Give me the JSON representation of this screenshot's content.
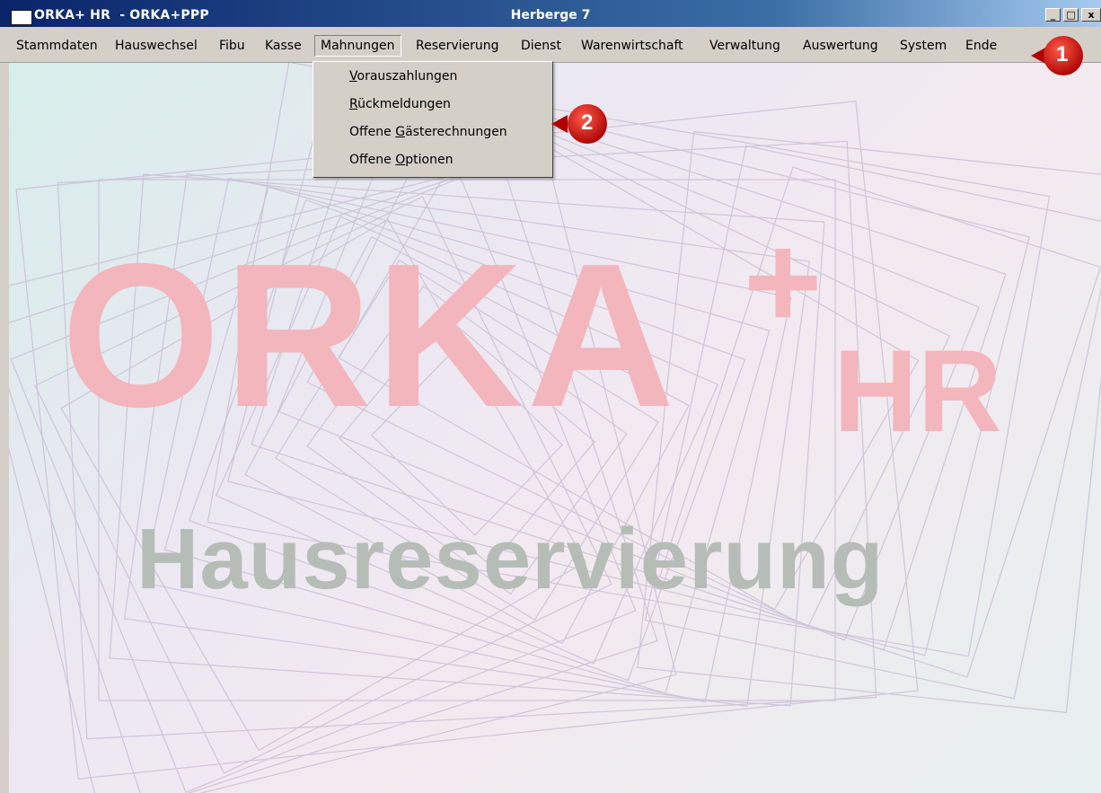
{
  "window": {
    "title_left": "ORKA+ HR  - ORKA+PPP",
    "title_center": "Herberge 7",
    "buttons": {
      "minimize": "_",
      "maximize": "□",
      "close": "x"
    }
  },
  "menubar": {
    "items": [
      "Stammdaten",
      "Hauswechsel",
      "Fibu",
      "Kasse",
      "Mahnungen",
      "Reservierung",
      "Dienst",
      "Warenwirtschaft",
      "Verwaltung",
      "Auswertung",
      "System",
      "Ende"
    ],
    "active": "Mahnungen"
  },
  "dropdown": {
    "items": [
      {
        "pre": "",
        "mnemonic": "V",
        "post": "orauszahlungen"
      },
      {
        "pre": "",
        "mnemonic": "R",
        "post": "ückmeldungen"
      },
      {
        "pre": "Offene ",
        "mnemonic": "G",
        "post": "ästerechnungen"
      },
      {
        "pre": "Offene ",
        "mnemonic": "O",
        "post": "ptionen"
      }
    ]
  },
  "logo": {
    "brand": "ORKA",
    "plus": "+",
    "suffix": "HR",
    "subtitle": "Hausreservierung"
  },
  "callouts": [
    {
      "label": "1"
    },
    {
      "label": "2"
    }
  ],
  "colors": {
    "title_start": "#0a246a",
    "logo_pink": "#f3b6bd",
    "logo_gray": "#b6bdb7",
    "callout_red": "#cc0000"
  }
}
